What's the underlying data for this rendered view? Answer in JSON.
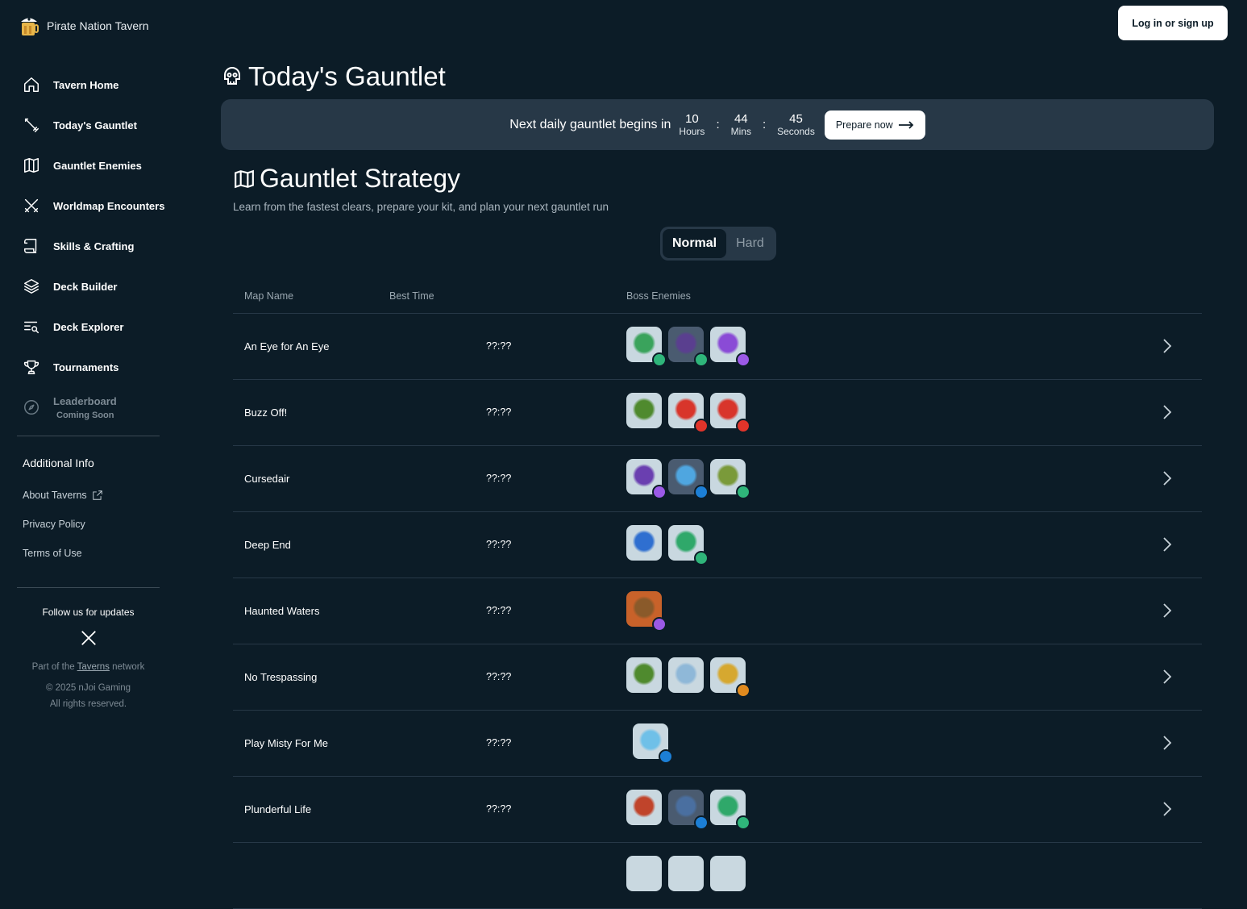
{
  "app": {
    "brand": "Pirate Nation Tavern"
  },
  "header": {
    "login_label": "Log in or sign up"
  },
  "sidebar": {
    "items": [
      {
        "label": "Tavern Home",
        "icon": "home-icon"
      },
      {
        "label": "Today's Gauntlet",
        "icon": "sword-icon"
      },
      {
        "label": "Gauntlet Enemies",
        "icon": "map-icon"
      },
      {
        "label": "Worldmap Encounters",
        "icon": "crossed-swords-icon"
      },
      {
        "label": "Skills & Crafting",
        "icon": "scroll-icon"
      },
      {
        "label": "Deck Builder",
        "icon": "layers-icon"
      },
      {
        "label": "Deck Explorer",
        "icon": "list-search-icon"
      },
      {
        "label": "Tournaments",
        "icon": "trophy-icon"
      },
      {
        "label": "Leaderboard",
        "sub": "Coming Soon",
        "icon": "compass-icon"
      }
    ],
    "additional_title": "Additional Info",
    "links": [
      "About Taverns",
      "Privacy Policy",
      "Terms of Use"
    ],
    "follow_title": "Follow us for updates",
    "part_of_prefix": "Part of the",
    "part_of_link": "Taverns",
    "part_of_suffix": "network",
    "copyright": "© 2025 nJoi Gaming",
    "rights": "All rights reserved."
  },
  "main": {
    "title": "Today's Gauntlet",
    "banner": {
      "text": "Next daily gauntlet begins in",
      "hours": "10",
      "hours_label": "Hours",
      "mins": "44",
      "mins_label": "Mins",
      "secs": "45",
      "secs_label": "Seconds",
      "prepare_label": "Prepare now"
    },
    "strategy_title": "Gauntlet Strategy",
    "strategy_sub": "Learn from the fastest clears, prepare your kit, and plan your next gauntlet run",
    "toggle": {
      "normal": "Normal",
      "hard": "Hard",
      "selected": "Normal"
    },
    "table": {
      "headers": [
        "Map Name",
        "Best Time",
        "Boss Enemies"
      ],
      "rows": [
        {
          "name": "An Eye for An Eye",
          "time": "??:??"
        },
        {
          "name": "Buzz Off!",
          "time": "??:??"
        },
        {
          "name": "Cursedair",
          "time": "??:??"
        },
        {
          "name": "Deep End",
          "time": "??:??"
        },
        {
          "name": "Haunted Waters",
          "time": "??:??"
        },
        {
          "name": "No Trespassing",
          "time": "??:??"
        },
        {
          "name": "Play Misty For Me",
          "time": "??:??"
        },
        {
          "name": "Plunderful Life",
          "time": "??:??"
        }
      ]
    }
  },
  "colors": {
    "background": "#0c1c27",
    "panel": "#273847",
    "wind": "#2fb57a",
    "fire": "#e0342a",
    "water": "#1c7fd6",
    "lightning": "#9b59e6",
    "earth": "#e08a1e"
  }
}
